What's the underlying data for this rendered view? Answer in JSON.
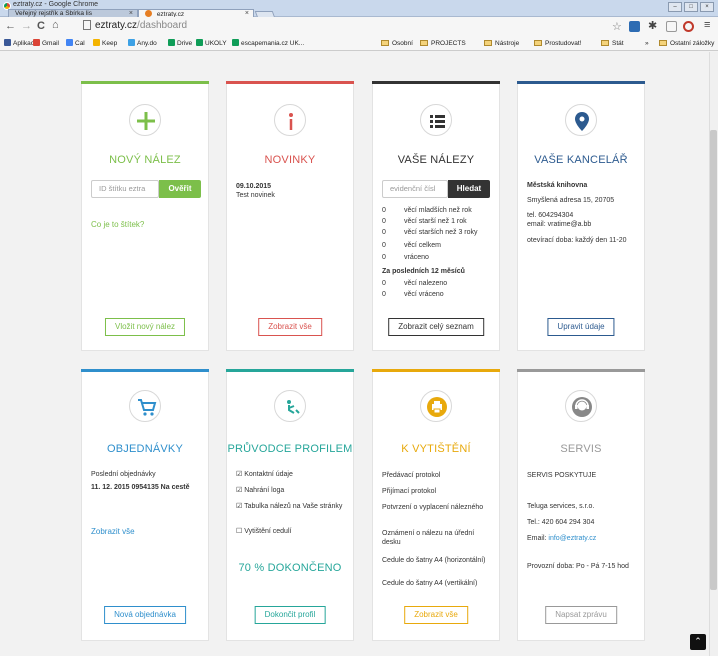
{
  "browser": {
    "app_name": "eztraty.cz - Google Chrome",
    "tabs": [
      {
        "label": "Veřejný rejstřík a Sbírka lis"
      },
      {
        "label": "eztraty.cz"
      }
    ],
    "url_domain": "eztraty.cz",
    "url_path": "/dashboard",
    "bookmarks": [
      {
        "label": "Aplikace",
        "color": "#3b5998"
      },
      {
        "label": "Gmail",
        "color": "#db4437"
      },
      {
        "label": "Cal",
        "color": "#4285f4"
      },
      {
        "label": "Keep",
        "color": "#f4b400"
      },
      {
        "label": "Any.do",
        "color": "#3da1e5"
      },
      {
        "label": "Drive",
        "color": "#0f9d58"
      },
      {
        "label": "UKOLY",
        "color": "#0f9d58"
      },
      {
        "label": "escapemania.cz UK...",
        "color": "#0f9d58"
      },
      {
        "label": "Osobní",
        "folder": true
      },
      {
        "label": "PROJECTS",
        "folder": true
      },
      {
        "label": "Nástroje",
        "folder": true
      },
      {
        "label": "Prostudovat!",
        "folder": true
      },
      {
        "label": "Stát",
        "folder": true
      }
    ],
    "bookmarks_more": "»",
    "other_bookmarks": "Ostatní záložky"
  },
  "cards": {
    "novy_nalez": {
      "title": "NOVÝ NÁLEZ",
      "color": "#7cbf4a",
      "input_placeholder": "ID štítku eztra",
      "input_button": "Ověřit",
      "link": "Co je to štítek?",
      "button": "Vložit nový nález"
    },
    "novinky": {
      "title": "NOVINKY",
      "color": "#d9534f",
      "date": "09.10.2015",
      "text": "Test novinek",
      "button": "Zobrazit vše"
    },
    "vase_nalezy": {
      "title": "VAŠE NÁLEZY",
      "color": "#333333",
      "input_placeholder": "evidenční čísl",
      "input_button": "Hledat",
      "stats": [
        {
          "num": "0",
          "label": "věcí mladších než rok"
        },
        {
          "num": "0",
          "label": "věcí starší než 1 rok"
        },
        {
          "num": "0",
          "label": "věcí starších než 3 roky"
        },
        {
          "num": "0",
          "label": "věcí celkem"
        },
        {
          "num": "0",
          "label": "vráceno"
        }
      ],
      "period_label": "Za posledních 12 měsíců",
      "period_stats": [
        {
          "num": "0",
          "label": "věcí nalezeno"
        },
        {
          "num": "0",
          "label": "věcí vráceno"
        }
      ],
      "button": "Zobrazit celý seznam"
    },
    "vase_kancelar": {
      "title": "VAŠE KANCELÁŘ",
      "color": "#2c5a8f",
      "name": "Městská knihovna",
      "address": "Smyšlená adresa 15, 20705",
      "tel": "tel. 604294304",
      "email": "email: vratime@a.bb",
      "hours": "otevírací doba: každý den 11-20",
      "button": "Upravit údaje"
    },
    "objednavky": {
      "title": "OBJEDNÁVKY",
      "color": "#2f8fcc",
      "last_label": "Poslední objednávky",
      "last_value": "11. 12. 2015 0954135 Na cestě",
      "link": "Zobrazit vše",
      "button": "Nová objednávka"
    },
    "pruvodce": {
      "title": "PRŮVODCE PROFILEM",
      "color": "#26a69a",
      "checks": [
        {
          "mark": "☑",
          "label": "Kontaktní údaje"
        },
        {
          "mark": "☑",
          "label": "Nahrání loga"
        },
        {
          "mark": "☑",
          "label": "Tabulka nálezů na Vaše stránky"
        },
        {
          "mark": "☐",
          "label": "Vytištění cedulí"
        }
      ],
      "progress_text": "70 % DOKONČENO",
      "button": "Dokončit profil"
    },
    "vytisteni": {
      "title": "K VYTIŠTĚNÍ",
      "color": "#e8a90c",
      "items": [
        "Předávací protokol",
        "Přijímací protokol",
        "Potvrzení o vyplacení nálezného",
        "Oznámení o nálezu na úřední desku",
        "Cedule do šatny A4 (horizontální)",
        "Cedule do šatny A4 (vertikální)"
      ],
      "button": "Zobrazit vše"
    },
    "servis": {
      "title": "SERVIS",
      "color": "#999999",
      "provider_label": "SERVIS POSKYTUJE",
      "company": "Teluga services, s.r.o.",
      "tel": "Tel.: 420 604 294 304",
      "email_label": "Email: ",
      "email": "info@eztraty.cz",
      "hours": "Provozní doba: Po - Pá 7-15 hod",
      "button": "Napsat zprávu"
    }
  }
}
